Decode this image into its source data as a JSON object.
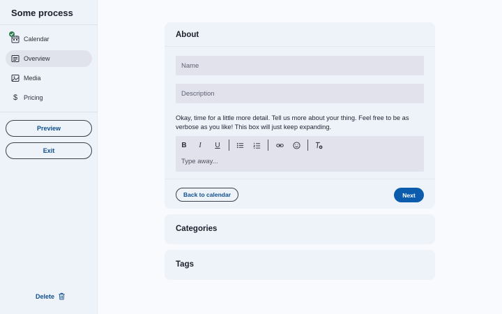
{
  "app": {
    "title": "Some process"
  },
  "sidebar": {
    "items": [
      {
        "label": "Calendar",
        "icon": "calendar-icon",
        "completed": true
      },
      {
        "label": "Overview",
        "icon": "overview-icon",
        "active": true
      },
      {
        "label": "Media",
        "icon": "image-icon"
      },
      {
        "label": "Pricing",
        "icon": "dollar-icon"
      }
    ],
    "preview_label": "Preview",
    "exit_label": "Exit",
    "delete_label": "Delete"
  },
  "about": {
    "title": "About",
    "name_placeholder": "Name",
    "description_placeholder": "Description",
    "help_text": "Okay, time for a little more detail. Tell us more about your thing. Feel free to be as verbose as you like! This box will just keep expanding.",
    "editor_placeholder": "Type away...",
    "toolbar": {
      "bold": "B",
      "italic": "I",
      "underline": "U"
    },
    "back_label": "Back to calendar",
    "next_label": "Next"
  },
  "categories": {
    "title": "Categories"
  },
  "tags": {
    "title": "Tags"
  },
  "colors": {
    "accent": "#0b5cad",
    "link": "#0f4f8f",
    "panel": "#eef2f9",
    "input": "#e1e2ec",
    "success": "#2e7d4f"
  }
}
